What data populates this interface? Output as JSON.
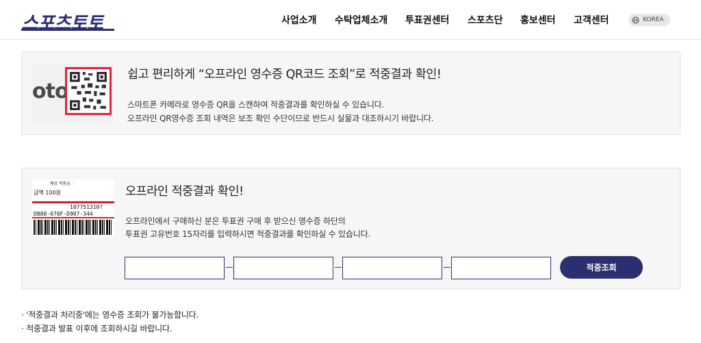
{
  "header": {
    "logo_text": "스포츠토토",
    "nav": [
      "사업소개",
      "수탁업체소개",
      "투표권센터",
      "스포츠단",
      "홍보센터",
      "고객센터"
    ],
    "lang_label": "KOREA"
  },
  "qr_section": {
    "thumb_text": "oto",
    "title": "쉽고 편리하게 “오프라인 영수증 QR코드 조회”로 적중결과 확인!",
    "desc_line1": "스마트폰 카메라로 영수증 QR을 스캔하여 적중결과를 확인하실 수 있습니다.",
    "desc_line2": "오프라인 QR영수증 조회 내역은 보조 확인 수단이므로 반드시 실물과 대조하시기 바랍니다."
  },
  "offline_section": {
    "ticket_header": "예상 적중금 :",
    "ticket_amount": "금액 100원",
    "ticket_number": "107751310?",
    "ticket_code": "DB88-070F-D907-344",
    "title": "오프라인 적중결과 확인!",
    "desc_line1": "오프라인에서 구매하신 분은 투표권 구매 후 받으신 영수증 하단의",
    "desc_line2": "투표권 고유번호 15자리를 입력하시면 적중결과를 확인하실 수 있습니다.",
    "inputs": [
      {
        "value": "",
        "placeholder": ""
      },
      {
        "value": "",
        "placeholder": ""
      },
      {
        "value": "",
        "placeholder": ""
      },
      {
        "value": "",
        "placeholder": ""
      }
    ],
    "button_label": "적중조회"
  },
  "notes": [
    "· '적중결과 처리중'에는 영수증 조회가 불가능합니다.",
    "· 적중결과 발표 이후에 조회하시길 바랍니다."
  ],
  "colors": {
    "brand": "#2b2e6f",
    "card_bg": "#f6f6f6",
    "qr_frame": "#e8213a",
    "ticket_bar": "#d4202e"
  }
}
